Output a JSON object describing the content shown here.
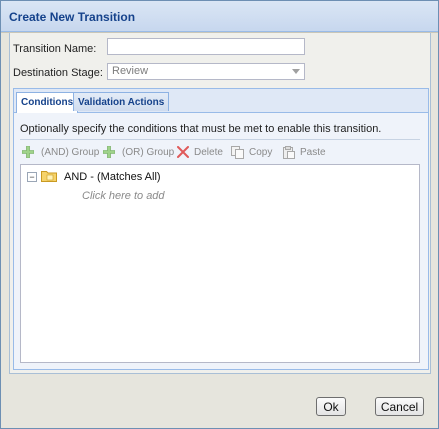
{
  "window": {
    "title": "Create New Transition"
  },
  "form": {
    "transition_name_label": "Transition Name:",
    "transition_name_value": "",
    "destination_stage_label": "Destination Stage:",
    "destination_stage_value": "Review"
  },
  "tabs": [
    {
      "label": "Conditions",
      "active": true
    },
    {
      "label": "Validation Actions",
      "active": false
    }
  ],
  "conditions": {
    "hint": "Optionally specify the conditions that must be met to enable this transition.",
    "toolbar": {
      "and_group": "(AND) Group",
      "or_group": "(OR) Group",
      "delete": "Delete",
      "copy": "Copy",
      "paste": "Paste"
    },
    "tree": {
      "root_label": "AND - (Matches All)",
      "expander": "⊟",
      "placeholder": "Click here to add"
    }
  },
  "buttons": {
    "ok": "Ok",
    "cancel": "Cancel"
  },
  "colors": {
    "title_text": "#15428b",
    "accent_green": "#8bc34a",
    "delete_red": "#e05a5a"
  }
}
